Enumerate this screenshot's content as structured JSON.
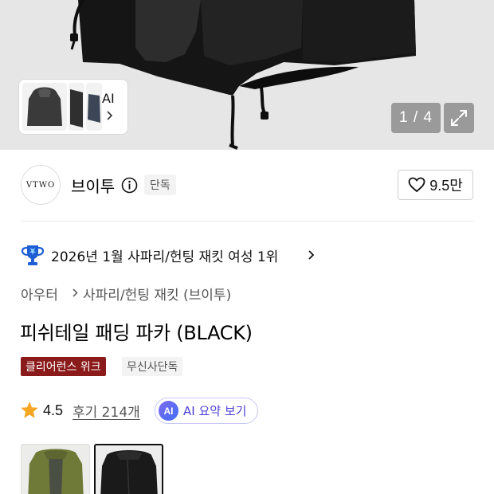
{
  "hero": {
    "ai_label": "AI",
    "counter": "1 / 4",
    "icons": {
      "expand": "expand-icon",
      "chevron": "chevron-right-icon"
    }
  },
  "brand": {
    "logo_text": "VTWO",
    "name": "브이투",
    "exclusive_badge": "단독",
    "likes": "9.5만",
    "icons": {
      "info": "info-icon",
      "like": "heart-outline-icon"
    }
  },
  "ranking": {
    "text": "2026년 1월 사파리/헌팅 재킷 여성 1위",
    "icon": "trophy-icon"
  },
  "breadcrumb": {
    "items": [
      "아우터",
      "사파리/헌팅 재킷 (브이투)"
    ]
  },
  "product": {
    "title": "피쉬테일 패딩 파카 (BLACK)"
  },
  "tags": {
    "clearance": "클리어런스 위크",
    "exclusive": "무신사단독"
  },
  "rating": {
    "score": "4.5",
    "review_link": "후기 214개",
    "ai_badge": "AI",
    "ai_summary": "AI 요약 보기",
    "icon": "star-icon"
  },
  "colors": {
    "options": [
      "khaki",
      "black"
    ],
    "selected": "black"
  },
  "palette": {
    "clearance_tag": "#8b1a1a",
    "ai_accent": "#4b3fd6",
    "star": "#f5a623"
  }
}
